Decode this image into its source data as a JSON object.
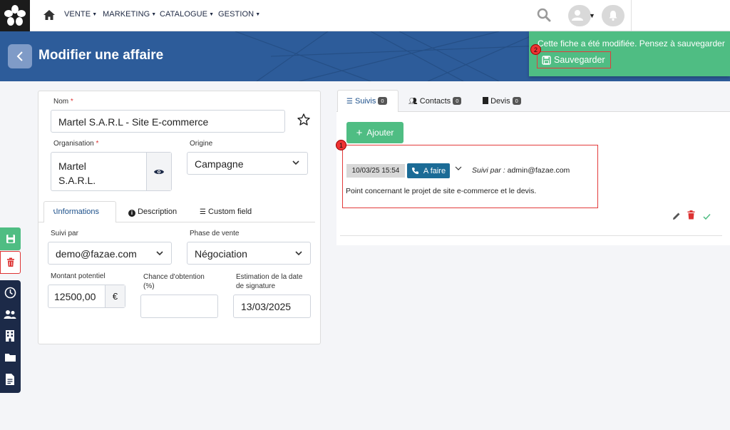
{
  "nav": {
    "items": [
      "VENTE",
      "MARKETING",
      "CATALOGUE",
      "GESTION"
    ]
  },
  "header": {
    "title": "Modifier une affaire"
  },
  "toast": {
    "message": "Cette fiche a été modifiée. Pensez à sauvegarder",
    "save_label": "Sauvegarder",
    "badge": "2"
  },
  "form": {
    "nom_label": "Nom",
    "nom_value": "Martel S.A.R.L - Site E-commerce",
    "org_label": "Organisation",
    "org_value_line1": "Martel",
    "org_value_line2": "S.A.R.L.",
    "origine_label": "Origine",
    "origine_value": "Campagne",
    "tabs": [
      "Informations",
      "Description",
      "Custom field"
    ],
    "suivi_par_label": "Suivi par",
    "suivi_par_value": "demo@fazae.com",
    "phase_label": "Phase de vente",
    "phase_value": "Négociation",
    "montant_label": "Montant potentiel",
    "montant_value": "12500,00",
    "currency": "€",
    "chance_label_1": "Chance d'obtention",
    "chance_label_2": "(%)",
    "chance_value": "",
    "estimation_label_1": "Estimation de la date",
    "estimation_label_2": "de signature",
    "estimation_value": "13/03/2025"
  },
  "right": {
    "tabs": [
      {
        "label": "Suivis",
        "count": "0"
      },
      {
        "label": "Contacts",
        "count": "0"
      },
      {
        "label": "Devis",
        "count": "0"
      }
    ],
    "add_label": "Ajouter",
    "badge": "1",
    "entry": {
      "date": "10/03/25 15:54",
      "status": "A faire",
      "suivi_prefix": "Suivi par :",
      "suivi_user": "admin@fazae.com",
      "note": "Point concernant le projet de site e-commerce et le devis."
    }
  },
  "colors": {
    "primary": "#2d5c9a",
    "success": "#4fbd83",
    "danger": "#d33333",
    "status_blue": "#1b6b96",
    "dark_nav": "#1c2a48"
  }
}
